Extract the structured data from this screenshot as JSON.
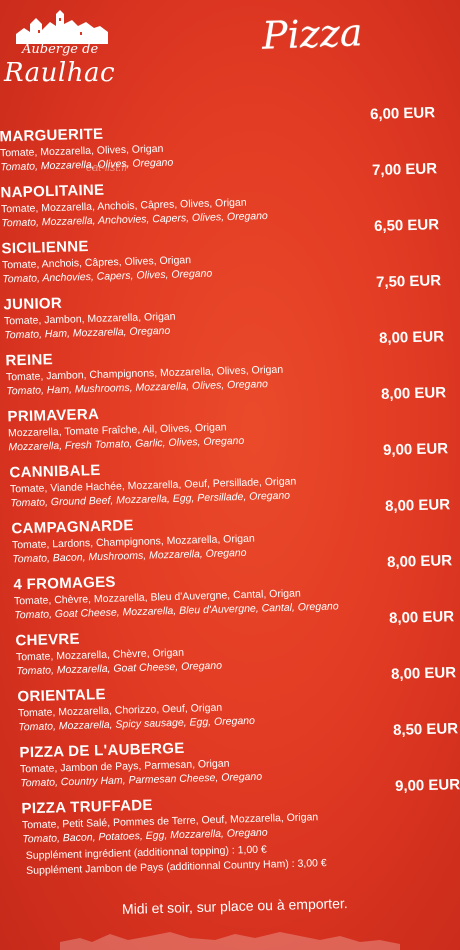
{
  "logo": {
    "line1": "Auberge de",
    "line2": "Raulhac"
  },
  "title": "Pizza",
  "watermark": "eat-list.fr",
  "items": [
    {
      "name": "MARGUERITE",
      "fr": "Tomate, Mozzarella, Olives, Origan",
      "en": "Tomato, Mozzarella, Olives, Oregano",
      "price": "6,00 EUR"
    },
    {
      "name": "NAPOLITAINE",
      "fr": "Tomate, Mozzarella, Anchois, Câpres, Olives, Origan",
      "en": "Tomato, Mozzarella, Anchovies, Capers, Olives, Oregano",
      "price": "7,00 EUR"
    },
    {
      "name": "SICILIENNE",
      "fr": "Tomate, Anchois, Câpres, Olives, Origan",
      "en": "Tomato, Anchovies, Capers, Olives, Oregano",
      "price": "6,50 EUR"
    },
    {
      "name": "JUNIOR",
      "fr": "Tomate, Jambon, Mozzarella, Origan",
      "en": "Tomato, Ham, Mozzarella, Oregano",
      "price": "7,50 EUR"
    },
    {
      "name": "REINE",
      "fr": "Tomate, Jambon, Champignons, Mozzarella, Olives, Origan",
      "en": "Tomato, Ham, Mushrooms, Mozzarella, Olives, Oregano",
      "price": "8,00 EUR"
    },
    {
      "name": "PRIMAVERA",
      "fr": "Mozzarella, Tomate Fraîche, Ail, Olives, Origan",
      "en": "Mozzarella, Fresh Tomato, Garlic, Olives, Oregano",
      "price": "8,00 EUR"
    },
    {
      "name": "CANNIBALE",
      "fr": "Tomate, Viande Hachée, Mozzarella, Oeuf, Persillade, Origan",
      "en": "Tomato, Ground Beef, Mozzarella, Egg, Persillade, Oregano",
      "price": "9,00 EUR"
    },
    {
      "name": "CAMPAGNARDE",
      "fr": "Tomate, Lardons, Champignons, Mozzarella, Origan",
      "en": "Tomato, Bacon, Mushrooms, Mozzarella, Oregano",
      "price": "8,00 EUR"
    },
    {
      "name": "4 FROMAGES",
      "fr": "Tomate, Chèvre, Mozzarella, Bleu d'Auvergne, Cantal, Origan",
      "en": "Tomato, Goat Cheese, Mozzarella, Bleu d'Auvergne, Cantal, Oregano",
      "price": "8,00 EUR"
    },
    {
      "name": "CHEVRE",
      "fr": "Tomate, Mozzarella, Chèvre, Origan",
      "en": "Tomato, Mozzarella, Goat Cheese, Oregano",
      "price": "8,00 EUR"
    },
    {
      "name": "ORIENTALE",
      "fr": "Tomate, Mozzarella, Chorizzo, Oeuf, Origan",
      "en": "Tomato, Mozzarella, Spicy sausage, Egg, Oregano",
      "price": "8,00 EUR"
    },
    {
      "name": "PIZZA DE L'AUBERGE",
      "fr": "Tomate, Jambon de Pays, Parmesan, Origan",
      "en": "Tomato, Country Ham, Parmesan Cheese, Oregano",
      "price": "8,50 EUR"
    },
    {
      "name": "PIZZA TRUFFADE",
      "fr": "Tomate, Petit Salé, Pommes de Terre, Oeuf, Mozzarella, Origan",
      "en": "Tomato, Bacon, Potatoes, Egg, Mozzarella, Oregano",
      "price": "9,00 EUR"
    }
  ],
  "supplements": [
    "Supplément ingrédient (additionnal topping) : 1,00 €",
    "Supplément Jambon de Pays (additionnal Country Ham) : 3,00 €"
  ],
  "footer": "Midi et soir, sur place ou à emporter."
}
